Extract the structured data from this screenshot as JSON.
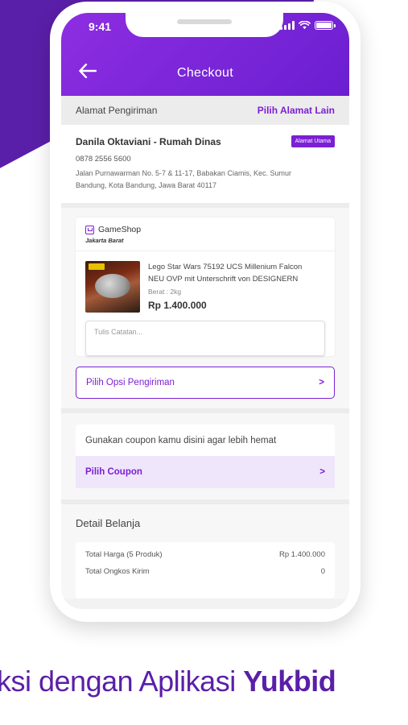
{
  "status_bar": {
    "time": "9:41"
  },
  "header": {
    "title": "Checkout",
    "back_icon": "arrow-left-icon"
  },
  "address_section": {
    "label": "Alamat Pengiriman",
    "change_link": "Pilih Alamat Lain",
    "recipient": "Danila Oktaviani - Rumah Dinas",
    "badge": "Alamat Utama",
    "phone": "0878 2556 5600",
    "address_line_1": "Jalan Purnawarman No. 5-7 & 11-17, Babakan Ciamis, Kec. Sumur",
    "address_line_2": "Bandung, Kota Bandung, Jawa Barat 40117"
  },
  "shop": {
    "name": "GameShop",
    "city": "Jakarta Barat",
    "icon": "store-icon"
  },
  "product": {
    "name_line_1": "Lego Star Wars 75192 UCS Millenium Falcon",
    "name_line_2": "NEU OVP mit Unterschrift von DESIGNERN",
    "weight": "Berat : 2kg",
    "price": "Rp 1.400.000"
  },
  "note": {
    "placeholder": "Tulis Catatan..."
  },
  "shipping": {
    "label": "Pilih Opsi Pengiriman",
    "chevron": ">"
  },
  "coupon": {
    "text": "Gunakan coupon kamu disini agar lebih hemat",
    "button": "Pilih Coupon",
    "chevron": ">"
  },
  "detail": {
    "title": "Detail Belanja",
    "rows": [
      {
        "label": "Total Harga (5 Produk)",
        "value": "Rp 1.400.000"
      },
      {
        "label": "Total Ongkos Kirim",
        "value": "0"
      }
    ]
  },
  "tagline": {
    "prefix": "ksi dengan Aplikasi ",
    "brand": "Yukbid"
  },
  "colors": {
    "primary": "#7c1fd4",
    "brand_dark": "#5a1fa8",
    "coupon_bg": "#efe6fb"
  }
}
